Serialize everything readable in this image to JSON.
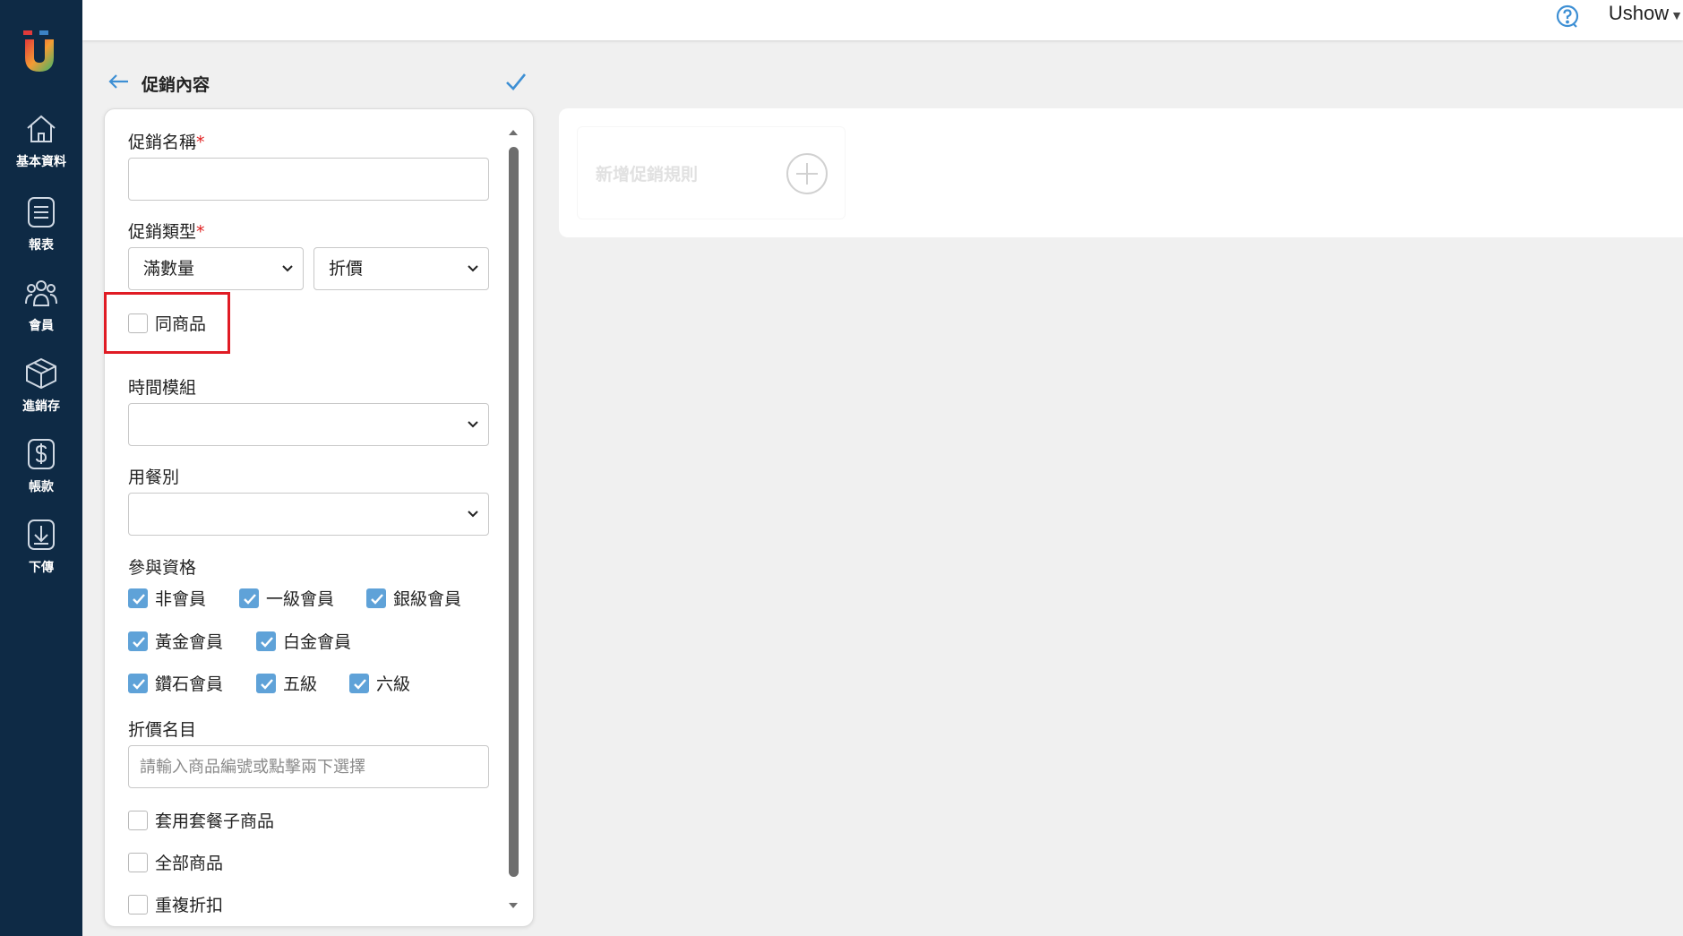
{
  "app": {
    "brand_colors": {
      "sidebar": "#0e2a45",
      "accent": "#5fa2d8",
      "highlight": "#e01b24"
    }
  },
  "sidebar": {
    "items": [
      {
        "label": "基本資料",
        "icon": "home-icon"
      },
      {
        "label": "報表",
        "icon": "report-icon"
      },
      {
        "label": "會員",
        "icon": "members-icon"
      },
      {
        "label": "進銷存",
        "icon": "inventory-box-icon"
      },
      {
        "label": "帳款",
        "icon": "dollar-icon"
      },
      {
        "label": "下傳",
        "icon": "download-icon"
      }
    ]
  },
  "topbar": {
    "user": "Ushow",
    "help_icon": "question-circle-icon"
  },
  "header": {
    "title": "促銷內容"
  },
  "form": {
    "name_label": "促銷名稱",
    "name_value": "",
    "type_label": "促銷類型",
    "type_primary": "滿數量",
    "type_secondary": "折價",
    "same_product_label": "同商品",
    "same_product_checked": false,
    "time_module_label": "時間模組",
    "time_module_value": "",
    "meal_type_label": "用餐別",
    "meal_type_value": "",
    "eligibility_label": "參與資格",
    "eligibility": [
      {
        "label": "非會員",
        "checked": true
      },
      {
        "label": "一級會員",
        "checked": true
      },
      {
        "label": "銀級會員",
        "checked": true
      },
      {
        "label": "黃金會員",
        "checked": true
      },
      {
        "label": "白金會員",
        "checked": true
      },
      {
        "label": "鑽石會員",
        "checked": true
      },
      {
        "label": "五級",
        "checked": true
      },
      {
        "label": "六級",
        "checked": true
      }
    ],
    "discount_item_label": "折價名目",
    "discount_item_placeholder": "請輸入商品編號或點擊兩下選擇",
    "apply_combo_label": "套用套餐子商品",
    "all_products_label": "全部商品",
    "repeat_discount_label": "重複折扣"
  },
  "rules": {
    "add_rule_label": "新增促銷規則"
  }
}
